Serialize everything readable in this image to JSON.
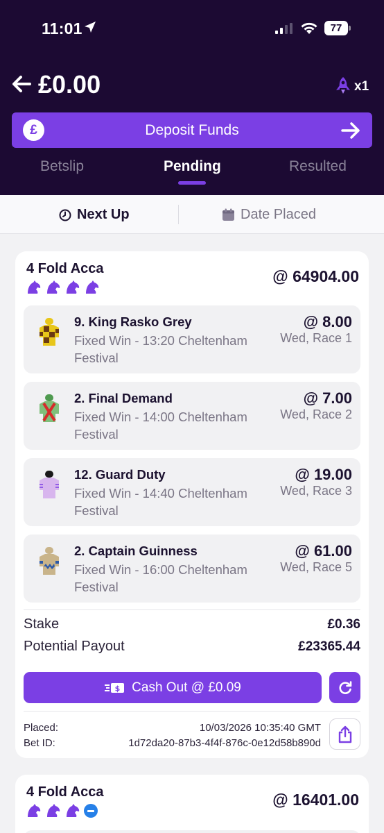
{
  "status_bar": {
    "time": "11:01",
    "battery": "77"
  },
  "header": {
    "balance": "£0.00",
    "boost_count": "x1",
    "deposit": {
      "icon": "pound-icon",
      "currency_symbol": "£",
      "label": "Deposit Funds"
    },
    "tabs": [
      {
        "label": "Betslip",
        "active": false
      },
      {
        "label": "Pending",
        "active": true
      },
      {
        "label": "Resulted",
        "active": false
      }
    ]
  },
  "sort": {
    "next_up": "Next Up",
    "date_placed": "Date Placed"
  },
  "bets": [
    {
      "title": "4 Fold Acca",
      "odds": "@ 64904.00",
      "legs": [
        {
          "name": "9. King Rasko Grey",
          "desc": "Fixed Win - 13:20 Cheltenham Festival",
          "odds": "@ 8.00",
          "race": "Wed, Race 1",
          "silk": "yellow-brown-check"
        },
        {
          "name": "2. Final Demand",
          "desc": "Fixed Win - 14:00 Cheltenham Festival",
          "odds": "@ 7.00",
          "race": "Wed, Race 2",
          "silk": "green-red-cross"
        },
        {
          "name": "12. Guard Duty",
          "desc": "Fixed Win - 14:40 Cheltenham Festival",
          "odds": "@ 19.00",
          "race": "Wed, Race 3",
          "silk": "lilac-black-cap"
        },
        {
          "name": "2. Captain Guinness",
          "desc": "Fixed Win - 16:00 Cheltenham Festival",
          "odds": "@ 61.00",
          "race": "Wed, Race 5",
          "silk": "beige-blue-diamonds"
        }
      ],
      "stake_label": "Stake",
      "stake": "£0.36",
      "payout_label": "Potential Payout",
      "payout": "£23365.44",
      "cashout_label": "Cash Out @ £0.09",
      "placed_label": "Placed:",
      "placed": "10/03/2026 10:35:40 GMT",
      "bet_id_label": "Bet ID:",
      "bet_id": "1d72da20-87b3-4f4f-876c-0e12d58b890d"
    },
    {
      "title": "4 Fold Acca",
      "odds": "@ 16401.00"
    }
  ],
  "colors": {
    "header_bg": "#1c0a33",
    "accent": "#7b3fe4",
    "leg_bg": "#f1f1f3",
    "void_badge": "#2680e8"
  }
}
